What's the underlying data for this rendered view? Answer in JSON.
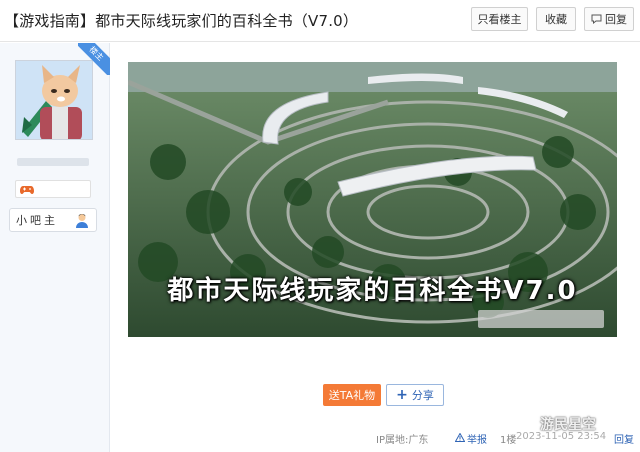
{
  "header": {
    "title": "【游戏指南】都市天际线玩家们的百科全书（V7.0）",
    "buttons": {
      "only_op": "只看楼主",
      "favorite": "收藏",
      "reply": "回复"
    }
  },
  "sidebar": {
    "badge": "楼主",
    "role": "小吧主"
  },
  "post": {
    "hero_text": "都市天际线玩家的百科全书V7.0",
    "actions": {
      "gift": "送TA礼物",
      "share": "分享"
    },
    "meta": {
      "ip": "IP属地:广东",
      "report": "举报",
      "floor": "1楼",
      "date": "2023-11-05 23:54",
      "reply": "回复"
    },
    "watermark": "游民星空"
  },
  "colors": {
    "accent_blue": "#2f64b5",
    "gift_orange": "#f47a36",
    "badge_blue": "#4a90e2"
  }
}
